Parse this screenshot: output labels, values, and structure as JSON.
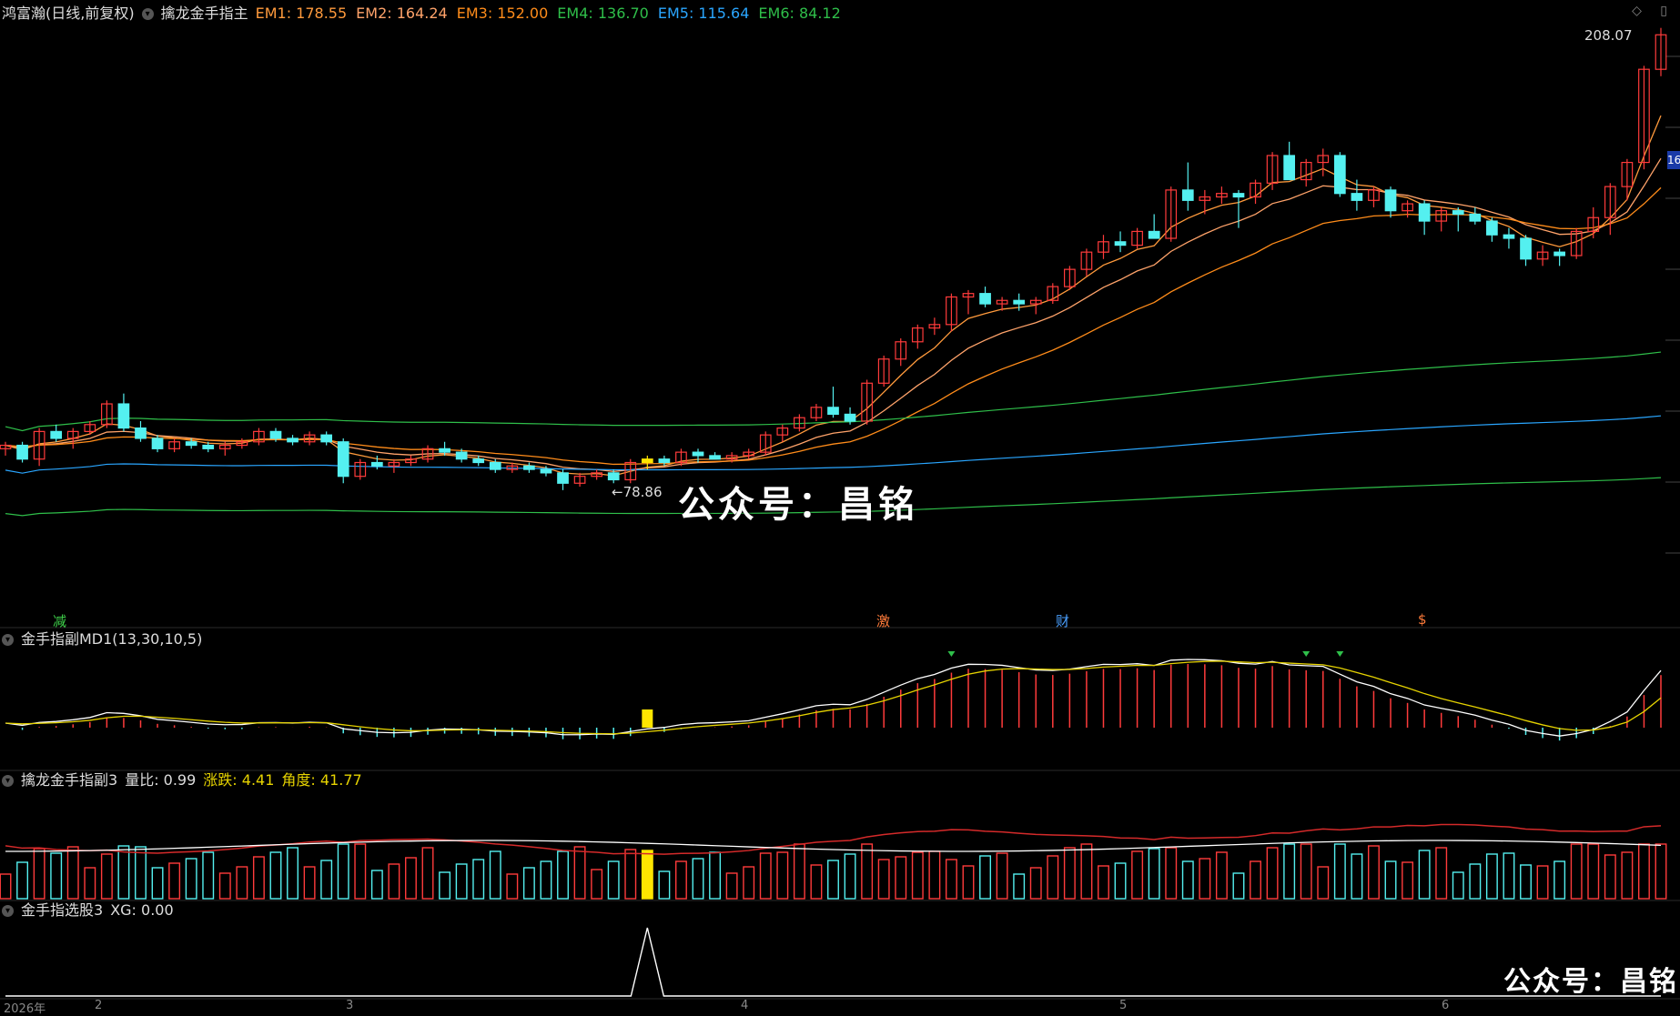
{
  "main": {
    "stock": "鸿富瀚(日线,前复权)",
    "indicator": "擒龙金手指主",
    "em": [
      {
        "label": "EM1: 178.55",
        "color": "#ff9a3c"
      },
      {
        "label": "EM2: 164.24",
        "color": "#ffa36a"
      },
      {
        "label": "EM3: 152.00",
        "color": "#ff8c1a"
      },
      {
        "label": "EM4: 136.70",
        "color": "#2fbf4a"
      },
      {
        "label": "EM5: 115.64",
        "color": "#2aa6ff"
      },
      {
        "label": "EM6: 84.12",
        "color": "#2fbf4a"
      }
    ],
    "high_label": "208.07",
    "low_label": "←78.86",
    "right_tag": "16",
    "event_tags": [
      {
        "text": "减",
        "color": "#3fd14a"
      },
      {
        "text": "激",
        "color": "#ff7b3a"
      },
      {
        "text": "财",
        "color": "#4aa0ff"
      },
      {
        "text": "$",
        "color": "#ff7b3a"
      }
    ]
  },
  "sub1": {
    "title": "金手指副MD1(13,30,10,5)"
  },
  "sub2": {
    "title": "擒龙金手指副3",
    "items": [
      {
        "label": "量比: 0.99",
        "color": "#dddddd"
      },
      {
        "label": "涨跌: 4.41",
        "color": "#e6d300"
      },
      {
        "label": "角度: 41.77",
        "color": "#e6d300"
      }
    ]
  },
  "sub3": {
    "title": "金手指选股3",
    "value": "XG: 0.00"
  },
  "x_axis": {
    "labels": [
      "2026年",
      "2",
      "3",
      "4",
      "5",
      "6"
    ]
  },
  "watermark": {
    "center": "公众号：昌铭",
    "corner": "公众号：昌铭"
  },
  "colors": {
    "up": "#ff3b3b",
    "down": "#54f0f0",
    "highlight": "#ffe600"
  },
  "chart_data": {
    "type": "candlestick",
    "ohlc_approx": [
      [
        88,
        90,
        86,
        89
      ],
      [
        89,
        90,
        84,
        85
      ],
      [
        85,
        94,
        83,
        93
      ],
      [
        93,
        95,
        90,
        91
      ],
      [
        91,
        94,
        88,
        93
      ],
      [
        93,
        96,
        92,
        95
      ],
      [
        95,
        102,
        94,
        101
      ],
      [
        101,
        104,
        93,
        94
      ],
      [
        94,
        96,
        90,
        91
      ],
      [
        91,
        92,
        87,
        88
      ],
      [
        88,
        91,
        87,
        90
      ],
      [
        90,
        91,
        88,
        89
      ],
      [
        89,
        90,
        87,
        88
      ],
      [
        88,
        90,
        86,
        89
      ],
      [
        89,
        91,
        88,
        90
      ],
      [
        90,
        94,
        89,
        93
      ],
      [
        93,
        94,
        90,
        91
      ],
      [
        91,
        92,
        89,
        90
      ],
      [
        90,
        93,
        89,
        92
      ],
      [
        92,
        93,
        89,
        90
      ],
      [
        90,
        91,
        78,
        80
      ],
      [
        80,
        85,
        79,
        84
      ],
      [
        84,
        86,
        82,
        83
      ],
      [
        83,
        85,
        81,
        84
      ],
      [
        84,
        86,
        83,
        85
      ],
      [
        85,
        89,
        84,
        88
      ],
      [
        88,
        90,
        86,
        87
      ],
      [
        87,
        88,
        84,
        85
      ],
      [
        85,
        86,
        83,
        84
      ],
      [
        84,
        85,
        81,
        82
      ],
      [
        82,
        84,
        81,
        83
      ],
      [
        83,
        84,
        81,
        82
      ],
      [
        82,
        83,
        80,
        81
      ],
      [
        81,
        82,
        76,
        78
      ],
      [
        78,
        81,
        77,
        80
      ],
      [
        80,
        82,
        79,
        81
      ],
      [
        81,
        82,
        78,
        79
      ],
      [
        79,
        85,
        78,
        84
      ],
      [
        84,
        86,
        82,
        85
      ],
      [
        85,
        86,
        83,
        84
      ],
      [
        84,
        88,
        83,
        87
      ],
      [
        87,
        88,
        84,
        86
      ],
      [
        86,
        87,
        85,
        85
      ],
      [
        85,
        87,
        84,
        86
      ],
      [
        86,
        88,
        85,
        87
      ],
      [
        87,
        93,
        86,
        92
      ],
      [
        92,
        95,
        90,
        94
      ],
      [
        94,
        98,
        93,
        97
      ],
      [
        97,
        101,
        96,
        100
      ],
      [
        100,
        106,
        97,
        98
      ],
      [
        98,
        100,
        95,
        96
      ],
      [
        96,
        108,
        95,
        107
      ],
      [
        107,
        115,
        106,
        114
      ],
      [
        114,
        120,
        112,
        119
      ],
      [
        119,
        124,
        117,
        123
      ],
      [
        123,
        126,
        121,
        124
      ],
      [
        124,
        133,
        122,
        132
      ],
      [
        132,
        134,
        127,
        133
      ],
      [
        133,
        135,
        129,
        130
      ],
      [
        130,
        132,
        128,
        131
      ],
      [
        131,
        133,
        128,
        130
      ],
      [
        130,
        132,
        127,
        131
      ],
      [
        131,
        136,
        130,
        135
      ],
      [
        135,
        141,
        134,
        140
      ],
      [
        140,
        146,
        138,
        145
      ],
      [
        145,
        150,
        143,
        148
      ],
      [
        148,
        151,
        145,
        147
      ],
      [
        147,
        152,
        146,
        151
      ],
      [
        151,
        156,
        149,
        149
      ],
      [
        149,
        164,
        148,
        163
      ],
      [
        163,
        171,
        157,
        160
      ],
      [
        160,
        163,
        156,
        161
      ],
      [
        161,
        164,
        159,
        162
      ],
      [
        162,
        163,
        152,
        161
      ],
      [
        161,
        166,
        159,
        165
      ],
      [
        165,
        174,
        163,
        173
      ],
      [
        173,
        177,
        166,
        166
      ],
      [
        166,
        172,
        164,
        171
      ],
      [
        171,
        175,
        167,
        173
      ],
      [
        173,
        174,
        161,
        162
      ],
      [
        162,
        166,
        157,
        160
      ],
      [
        160,
        164,
        158,
        163
      ],
      [
        163,
        164,
        155,
        157
      ],
      [
        157,
        160,
        155,
        159
      ],
      [
        159,
        160,
        150,
        154
      ],
      [
        154,
        158,
        151,
        157
      ],
      [
        157,
        158,
        151,
        156
      ],
      [
        156,
        158,
        153,
        154
      ],
      [
        154,
        155,
        148,
        150
      ],
      [
        150,
        152,
        146,
        149
      ],
      [
        149,
        150,
        141,
        143
      ],
      [
        143,
        147,
        141,
        145
      ],
      [
        145,
        146,
        141,
        144
      ],
      [
        144,
        152,
        143,
        151
      ],
      [
        151,
        158,
        149,
        155
      ],
      [
        155,
        165,
        150,
        164
      ],
      [
        164,
        172,
        160,
        171
      ],
      [
        171,
        199,
        169,
        198
      ],
      [
        198,
        210,
        196,
        208
      ]
    ]
  }
}
